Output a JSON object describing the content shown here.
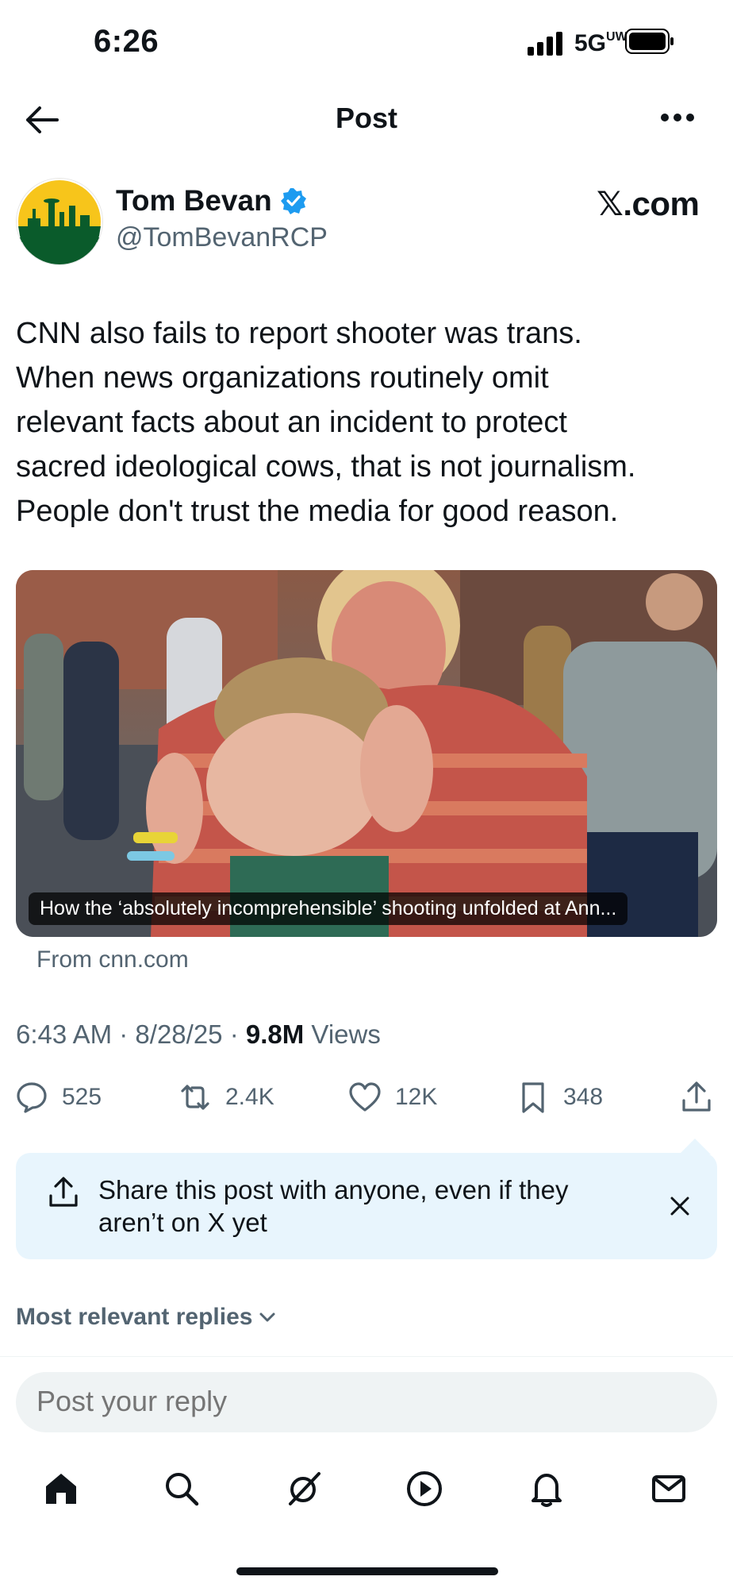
{
  "status_bar": {
    "time": "6:26",
    "network": "5G",
    "network_suffix": "UW"
  },
  "header": {
    "title": "Post"
  },
  "author": {
    "name": "Tom Bevan",
    "handle": "@TomBevanRCP",
    "brand": "𝕏.com"
  },
  "post": {
    "text": "CNN also fails to report shooter was trans.\nWhen news organizations routinely omit\nrelevant facts about an incident to protect\nsacred ideological cows, that is not journalism.\nPeople don't trust the media for good reason.",
    "card": {
      "caption": "How the ‘absolutely incomprehensible’ shooting unfolded at Ann...",
      "source": "From cnn.com"
    },
    "time": "6:43 AM",
    "date": "8/28/25",
    "views_count": "9.8M",
    "views_label": "Views",
    "separator": "·"
  },
  "actions": {
    "replies": "525",
    "reposts": "2.4K",
    "likes": "12K",
    "bookmarks": "348"
  },
  "share_banner": {
    "text": "Share this post with anyone, even if they aren’t on X yet"
  },
  "replies_filter": {
    "label": "Most relevant replies"
  },
  "reply_box": {
    "placeholder": "Post your reply"
  },
  "colors": {
    "accent": "#1d9bf0",
    "muted": "#536471",
    "banner_bg": "#e8f5fd",
    "text": "#0f1419"
  },
  "bottom_nav": [
    "home-icon",
    "search-icon",
    "grok-icon",
    "video-icon",
    "notifications-icon",
    "messages-icon"
  ]
}
